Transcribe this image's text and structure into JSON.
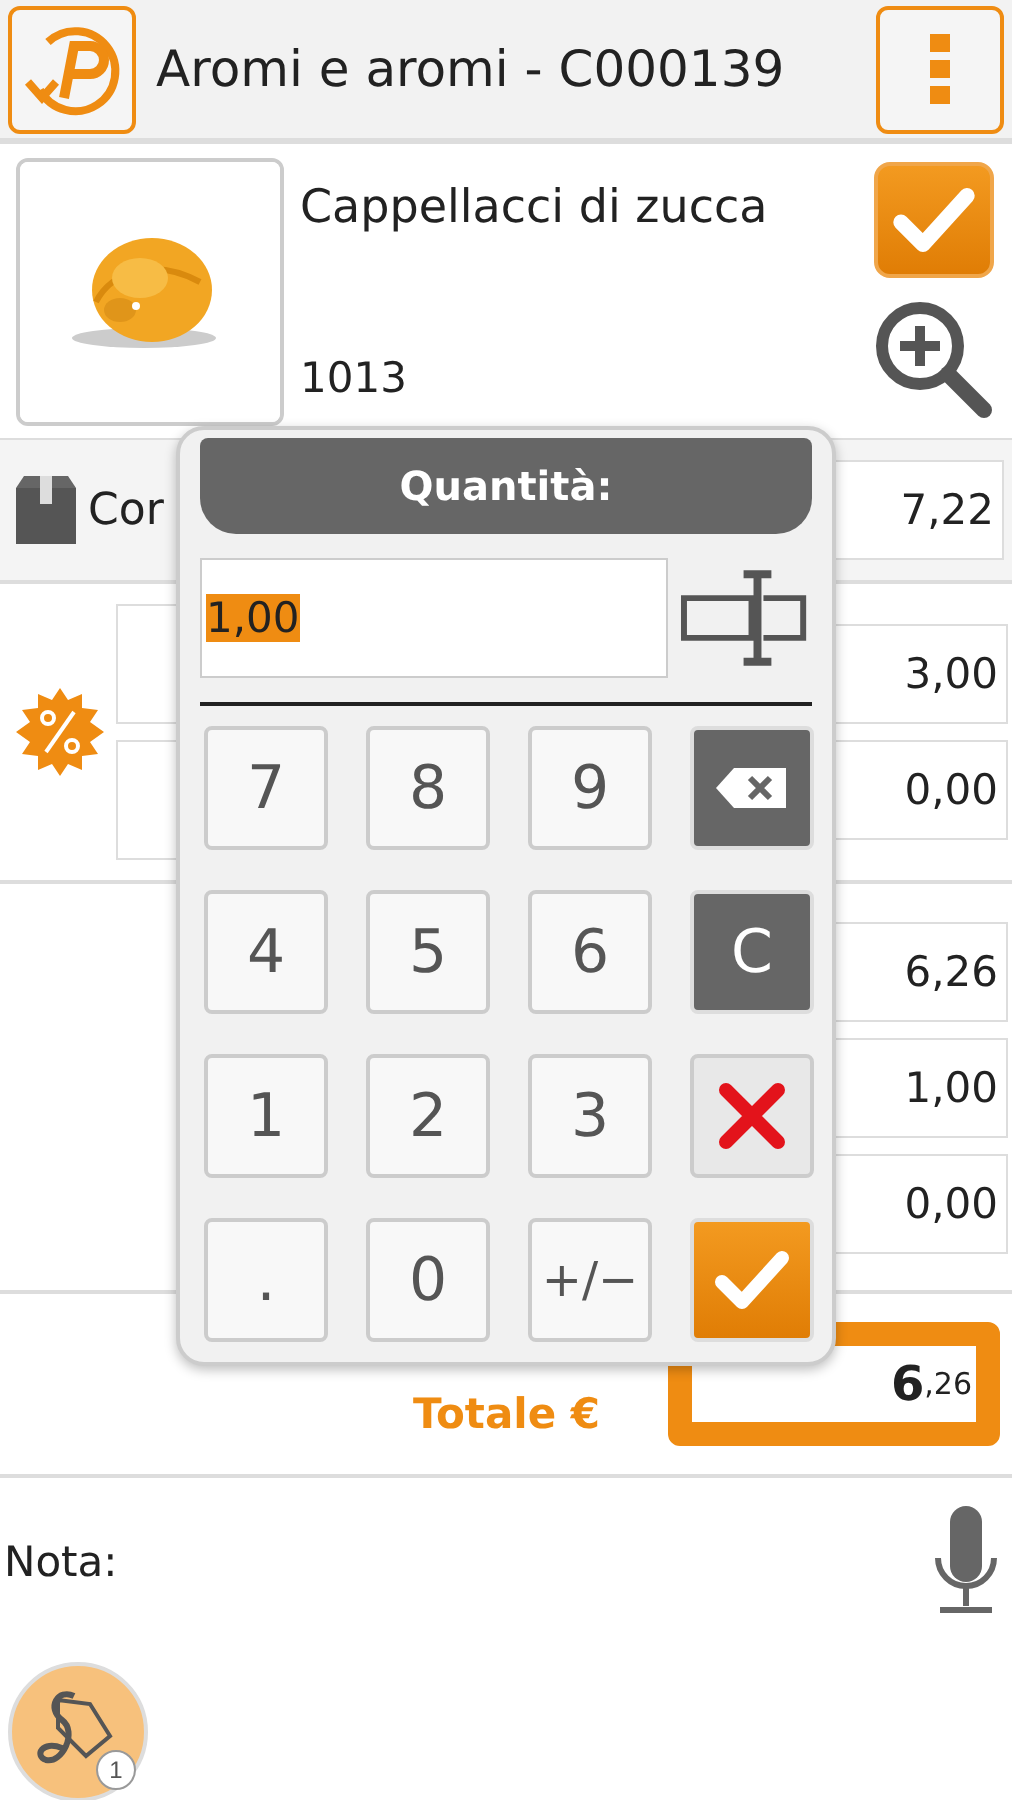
{
  "header": {
    "title": "Aromi e aromi - C000139"
  },
  "product": {
    "name": "Cappellacci di zucca",
    "code": "1013",
    "checked": true
  },
  "price_row": {
    "label": "Cor",
    "value": "7,22"
  },
  "discount_values": [
    "3,00",
    "0,00"
  ],
  "values": [
    "6,26",
    "1,00",
    "0,00"
  ],
  "total": {
    "label": "Totale €",
    "integer": "6",
    "decimals": ",26"
  },
  "note": {
    "label": "Nota:"
  },
  "attachment_badge": "1",
  "keypad": {
    "title": "Quantità:",
    "value": "1,00",
    "keys": [
      {
        "label": "7",
        "kind": "digit"
      },
      {
        "label": "8",
        "kind": "digit"
      },
      {
        "label": "9",
        "kind": "digit"
      },
      {
        "kind": "backspace"
      },
      {
        "label": "4",
        "kind": "digit"
      },
      {
        "label": "5",
        "kind": "digit"
      },
      {
        "label": "6",
        "kind": "digit"
      },
      {
        "label": "C",
        "kind": "clear"
      },
      {
        "label": "1",
        "kind": "digit"
      },
      {
        "label": "2",
        "kind": "digit"
      },
      {
        "label": "3",
        "kind": "digit"
      },
      {
        "kind": "cancel"
      },
      {
        "label": ".",
        "kind": "digit"
      },
      {
        "label": "0",
        "kind": "digit"
      },
      {
        "label": "+/−",
        "kind": "digit"
      },
      {
        "kind": "confirm"
      }
    ]
  }
}
